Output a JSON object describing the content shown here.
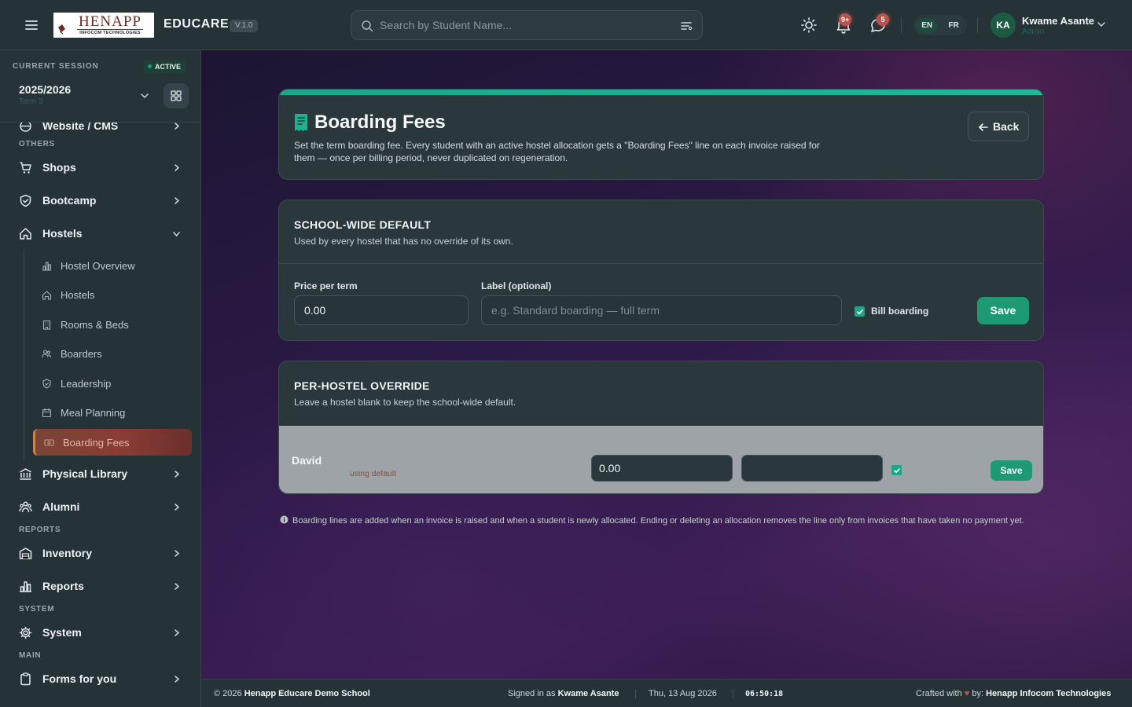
{
  "header": {
    "brand": "EDUCARE",
    "version": "V.1.0",
    "logo_text": "HENAPP",
    "logo_sub": "INFOCOM TECHNOLOGIES",
    "search_placeholder": "Search by Student Name...",
    "notifications_badge": "9+",
    "messages_badge": "5",
    "lang_en": "EN",
    "lang_fr": "FR",
    "user_initials": "KA",
    "user_name": "Kwame Asante",
    "user_role": "Admin"
  },
  "session": {
    "caption": "CURRENT SESSION",
    "status": "ACTIVE",
    "year": "2025/2026",
    "term": "Term 3"
  },
  "sidebar": {
    "partial_item": "Website / CMS",
    "cap_others": "OTHERS",
    "shops": "Shops",
    "bootcamp": "Bootcamp",
    "hostels": "Hostels",
    "hostel_sub": [
      "Hostel Overview",
      "Hostels",
      "Rooms & Beds",
      "Boarders",
      "Leadership",
      "Meal Planning",
      "Boarding Fees"
    ],
    "physical_library": "Physical Library",
    "alumni": "Alumni",
    "cap_reports": "REPORTS",
    "inventory": "Inventory",
    "reports": "Reports",
    "cap_system": "SYSTEM",
    "system": "System",
    "cap_main": "MAIN",
    "forms": "Forms for you"
  },
  "page": {
    "title": "Boarding Fees",
    "description": "Set the term boarding fee. Every student with an active hostel allocation gets a \"Boarding Fees\" line on each invoice raised for them — once per billing period, never duplicated on regeneration.",
    "back_label": "Back"
  },
  "default_section": {
    "title": "SCHOOL-WIDE DEFAULT",
    "subtitle": "Used by every hostel that has no override of its own.",
    "price_label": "Price per term",
    "price_value": "0.00",
    "label_label": "Label (optional)",
    "label_placeholder": "e.g. Standard boarding — full term",
    "bill_label": "Bill boarding",
    "bill_checked": true,
    "save_label": "Save"
  },
  "override_section": {
    "title": "PER-HOSTEL OVERRIDE",
    "subtitle": "Leave a hostel blank to keep the school-wide default.",
    "rows": [
      {
        "name": "David",
        "hint": "using default",
        "price": "0.00",
        "label": "",
        "checked": true,
        "save_label": "Save"
      }
    ]
  },
  "info_note": "Boarding lines are added when an invoice is raised and when a student is newly allocated. Ending or deleting an allocation removes the line only from invoices that have taken no payment yet.",
  "footer": {
    "copyright_prefix": "© 2026",
    "school": "Henapp Educare Demo School",
    "signed_prefix": "Signed in as",
    "signed_user": "Kwame Asante",
    "date": "Thu, 13 Aug 2026",
    "time": "06:50:18",
    "crafted_prefix": "Crafted with",
    "crafted_mid": "by:",
    "crafted_company": "Henapp Infocom Technologies"
  },
  "colors": {
    "accent_teal": "#1cb99a",
    "save_green": "#1d9a74",
    "active_nav": "#8a3c34",
    "badge_red": "#b8524a"
  }
}
